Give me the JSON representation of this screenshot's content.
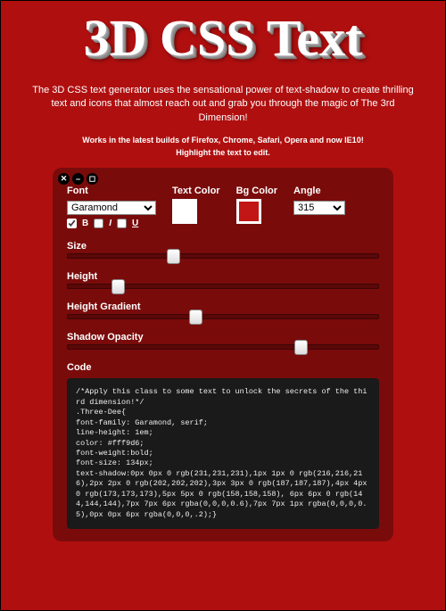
{
  "title": "3D CSS Text",
  "description": "The 3D CSS text generator uses the sensational power of text-shadow to create thrilling text and icons that almost reach out and grab you through the magic of The 3rd Dimension!",
  "sub1": "Works in the latest builds of Firefox, Chrome, Safari, Opera and now IE10!",
  "sub2": "Highlight the text to edit.",
  "controls": {
    "font": {
      "label": "Font",
      "value": "Garamond"
    },
    "style": {
      "bold_label": "B",
      "italic_label": "I",
      "underline_label": "U",
      "bold": true,
      "italic": false,
      "underline": false
    },
    "textColor": {
      "label": "Text Color",
      "value": "#ffffff"
    },
    "bgColor": {
      "label": "Bg Color",
      "value": "#c21616"
    },
    "angle": {
      "label": "Angle",
      "value": "315"
    }
  },
  "sliders": {
    "size": {
      "label": "Size",
      "pos": 32
    },
    "height": {
      "label": "Height",
      "pos": 14
    },
    "heightGradient": {
      "label": "Height Gradient",
      "pos": 39
    },
    "shadowOpacity": {
      "label": "Shadow Opacity",
      "pos": 73
    }
  },
  "code": {
    "label": "Code",
    "text": "/*Apply this class to some text to unlock the secrets of the third dimension!*/\n.Three-Dee{\nfont-family: Garamond, serif;\nline-height: 1em;\ncolor: #fff9d6;\nfont-weight:bold;\nfont-size: 134px;\ntext-shadow:0px 0px 0 rgb(231,231,231),1px 1px 0 rgb(216,216,216),2px 2px 0 rgb(202,202,202),3px 3px 0 rgb(187,187,187),4px 4px 0 rgb(173,173,173),5px 5px 0 rgb(158,158,158), 6px 6px 0 rgb(144,144,144),7px 7px 6px rgba(0,0,0,0.6),7px 7px 1px rgba(0,0,0,0.5),0px 0px 6px rgba(0,0,0,.2);}"
  }
}
